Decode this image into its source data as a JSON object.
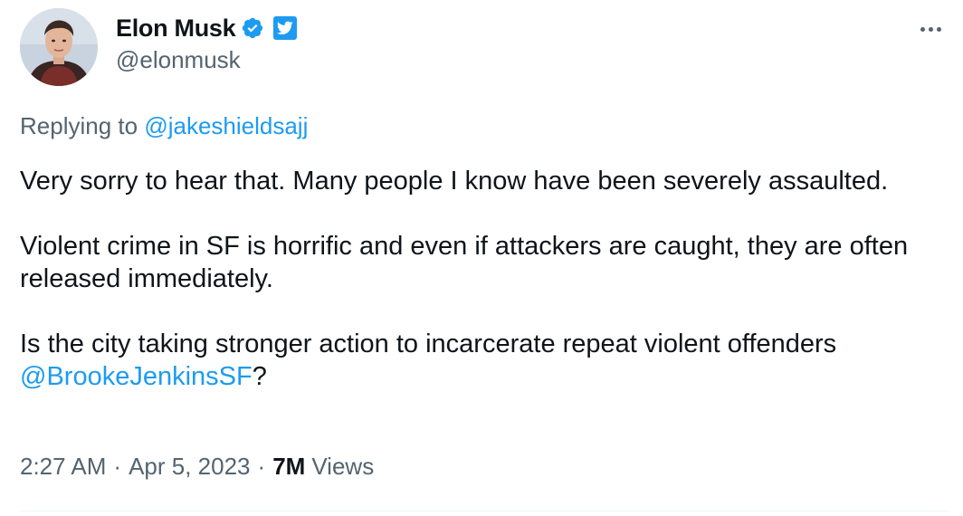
{
  "author": {
    "display_name": "Elon Musk",
    "handle": "@elonmusk",
    "verified_icon": "verified-badge-icon",
    "affiliate_icon": "twitter-bird-icon"
  },
  "reply": {
    "prefix": "Replying to",
    "mention": "@jakeshieldsajj"
  },
  "body": {
    "paragraph1": "Very sorry to hear that. Many people I know have been severely assaulted.",
    "paragraph2": "Violent crime in SF is horrific and even if attackers are caught, they are often released immediately.",
    "paragraph3_text": "Is the city taking stronger action to incarcerate repeat violent offenders",
    "paragraph3_mention": "@BrookeJenkinsSF",
    "paragraph3_suffix": "?"
  },
  "meta": {
    "time": "2:27 AM",
    "separator": "·",
    "date": "Apr 5, 2023",
    "views_count": "7M",
    "views_label": "Views"
  },
  "colors": {
    "accent": "#1d9bf0",
    "text": "#0f1419",
    "secondary": "#536471"
  }
}
